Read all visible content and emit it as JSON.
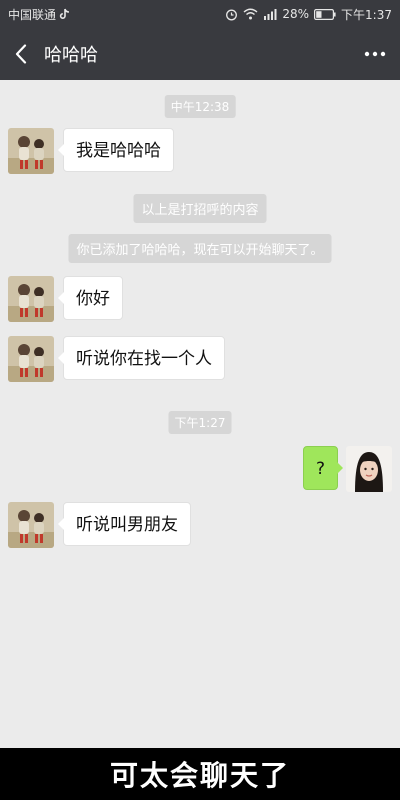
{
  "status_bar": {
    "carrier": "中国联通",
    "battery": "28%",
    "time": "下午1:37",
    "icons": [
      "tiktok-icon",
      "alarm-icon",
      "wifi-icon",
      "signal-icon",
      "battery-icon"
    ]
  },
  "header": {
    "title": "哈哈哈",
    "icons": [
      "back-arrow-icon",
      "more-icon"
    ]
  },
  "chat": {
    "time_1": "中午12:38",
    "msg_1": "我是哈哈哈",
    "system_1": "以上是打招呼的内容",
    "system_2": "你已添加了哈哈哈，现在可以开始聊天了。",
    "msg_2": "你好",
    "msg_3": "听说你在找一个人",
    "time_2": "下午1:27",
    "msg_4": "?",
    "msg_5": "听说叫男朋友"
  },
  "caption": "可太会聊天了",
  "colors": {
    "header_bg": "#393a3f",
    "chat_bg": "#ebebeb",
    "sent_bubble": "#9fe65b",
    "received_bubble": "#ffffff"
  }
}
